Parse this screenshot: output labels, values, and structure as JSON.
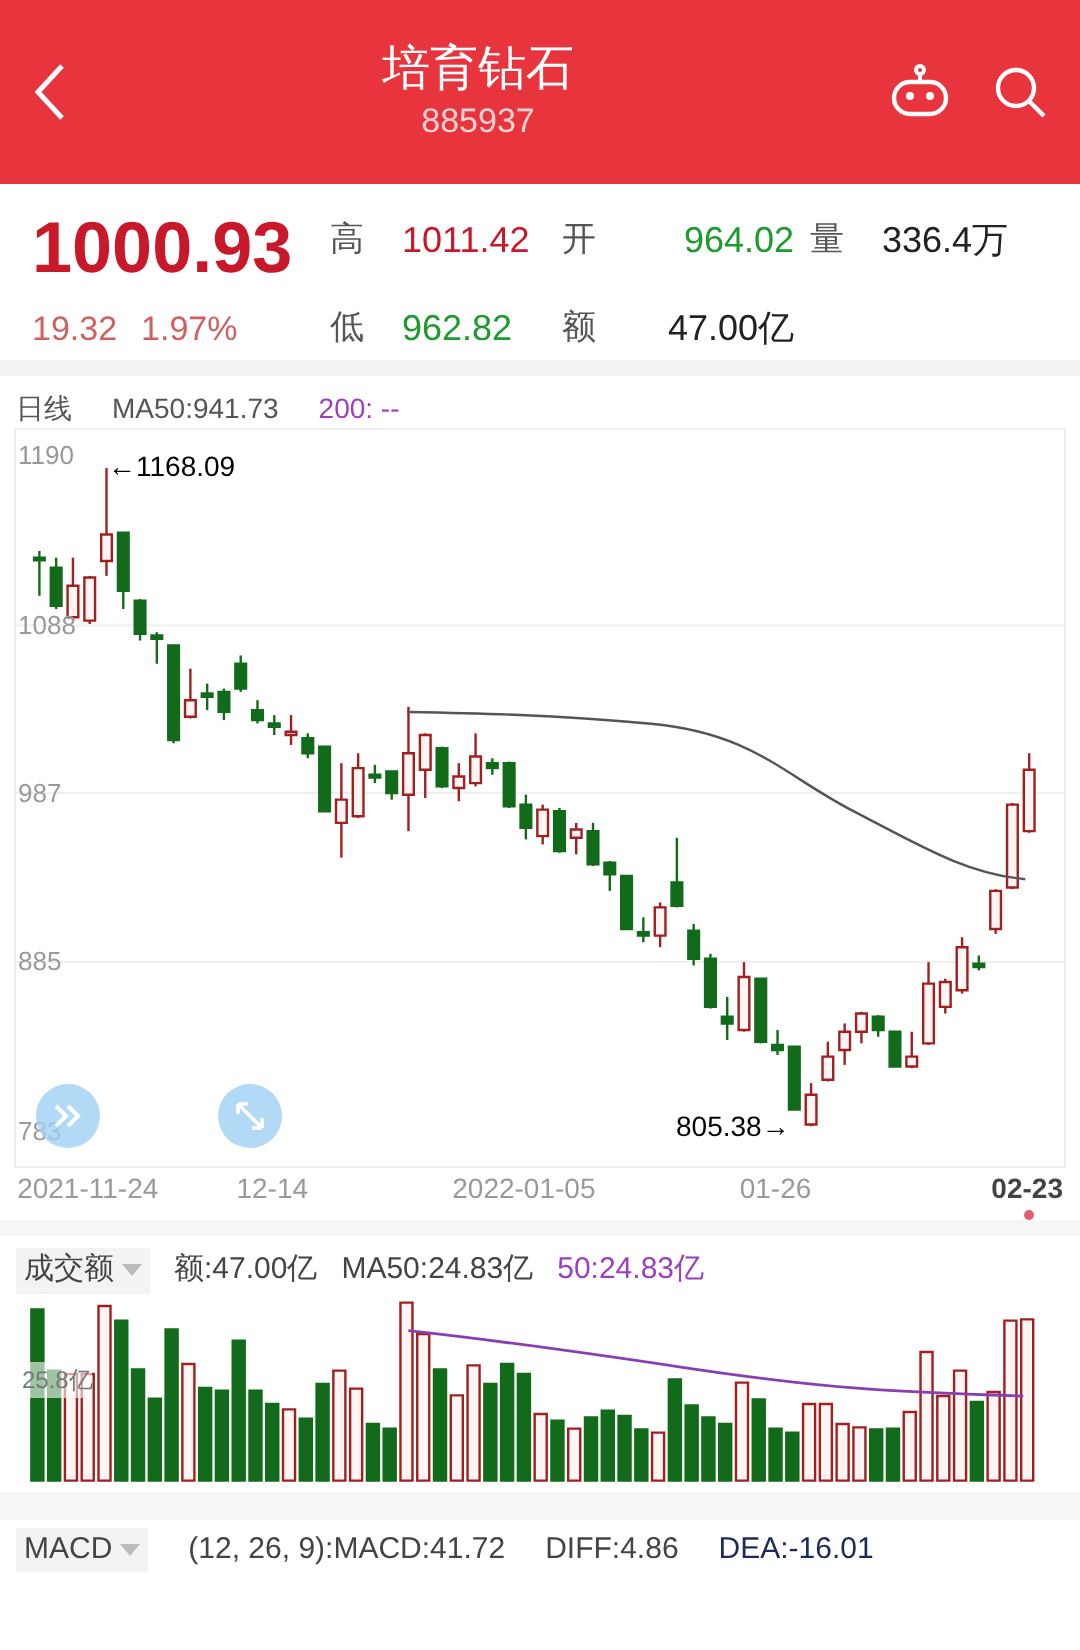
{
  "header": {
    "title": "培育钻石",
    "code": "885937"
  },
  "quote": {
    "price": "1000.93",
    "color": "#c8192a",
    "changes": [
      {
        "text": "19.32",
        "color": "#d06060"
      },
      {
        "text": "1.97%",
        "color": "#d06060"
      }
    ]
  },
  "stats": [
    [
      {
        "label": "高",
        "value": "1011.42",
        "color": "#c8192a"
      },
      {
        "label": "开",
        "value": "964.02",
        "color": "#1e9a2e"
      },
      {
        "label": "量",
        "value": "336.4万",
        "color": "#222222"
      }
    ],
    [
      {
        "label": "低",
        "value": "962.82",
        "color": "#1e9a2e"
      },
      {
        "label": "额",
        "value": "47.00亿",
        "color": "#222222"
      }
    ]
  ],
  "price_chart": {
    "period": "日线",
    "last_date_marked": true,
    "ma50": "MA50:941.73",
    "ma200": "200: --",
    "high_note": "←1168.09",
    "low_note": "805.38→",
    "chart_data": {
      "type": "candlestick",
      "ylim": [
        762,
        1206
      ],
      "yticks": [
        1190,
        1088,
        987,
        885,
        783
      ],
      "grid": true,
      "categories": [
        null,
        null,
        null,
        "2021-11-24",
        null,
        null,
        null,
        null,
        null,
        null,
        null,
        null,
        null,
        null,
        "12-14",
        null,
        null,
        null,
        null,
        null,
        null,
        null,
        null,
        null,
        null,
        null,
        null,
        null,
        null,
        "2022-01-05",
        null,
        null,
        null,
        null,
        null,
        null,
        null,
        null,
        null,
        null,
        null,
        null,
        null,
        null,
        "01-26",
        null,
        null,
        null,
        null,
        null,
        null,
        null,
        null,
        null,
        null,
        null,
        null,
        null,
        null,
        "02-23"
      ],
      "ohlc": [
        [
          1129,
          1133,
          1106,
          1128
        ],
        [
          1123,
          1129,
          1098,
          1100
        ],
        [
          1093,
          1129,
          1091,
          1112
        ],
        [
          1091,
          1118,
          1089,
          1117
        ],
        [
          1127,
          1183,
          1118,
          1143
        ],
        [
          1144,
          1144,
          1098,
          1109
        ],
        [
          1103,
          1104,
          1079,
          1083
        ],
        [
          1082,
          1084,
          1065,
          1080
        ],
        [
          1076,
          1076,
          1017,
          1019
        ],
        [
          1033,
          1062,
          1032,
          1043
        ],
        [
          1047,
          1053,
          1037,
          1045
        ],
        [
          1048,
          1050,
          1031,
          1036
        ],
        [
          1065,
          1070,
          1048,
          1050
        ],
        [
          1037,
          1043,
          1029,
          1031
        ],
        [
          1029,
          1034,
          1022,
          1027
        ],
        [
          1022,
          1034,
          1016,
          1024
        ],
        [
          1020,
          1023,
          1008,
          1011
        ],
        [
          1015,
          1015,
          976,
          976
        ],
        [
          969,
          1005,
          948,
          983
        ],
        [
          973,
          1011,
          972,
          1002
        ],
        [
          998,
          1004,
          993,
          997
        ],
        [
          1000,
          1000,
          983,
          987
        ],
        [
          986,
          1039,
          964,
          1011
        ],
        [
          1001,
          1023,
          984,
          1022
        ],
        [
          1014,
          1015,
          990,
          991
        ],
        [
          990,
          1005,
          982,
          997
        ],
        [
          993,
          1023,
          991,
          1009
        ],
        [
          1005,
          1008,
          998,
          1002
        ],
        [
          1005,
          1006,
          978,
          979
        ],
        [
          980,
          986,
          959,
          966
        ],
        [
          961,
          980,
          956,
          977
        ],
        [
          976,
          978,
          951,
          952
        ],
        [
          960,
          969,
          950,
          965
        ],
        [
          964,
          969,
          943,
          944
        ],
        [
          945,
          946,
          928,
          938
        ],
        [
          937,
          937,
          905,
          905
        ],
        [
          903,
          912,
          897,
          901
        ],
        [
          901,
          921,
          894,
          918
        ],
        [
          933,
          960,
          918,
          919
        ],
        [
          904,
          908,
          883,
          887
        ],
        [
          887,
          890,
          857,
          858
        ],
        [
          852,
          864,
          838,
          848
        ],
        [
          844,
          885,
          843,
          876
        ],
        [
          875,
          875,
          836,
          837
        ],
        [
          835,
          844,
          829,
          832
        ],
        [
          834,
          834,
          796,
          796
        ],
        [
          787,
          812,
          786,
          805
        ],
        [
          814,
          837,
          813,
          828
        ],
        [
          832,
          848,
          823,
          843
        ],
        [
          843,
          855,
          836,
          854
        ],
        [
          852,
          853,
          840,
          844
        ],
        [
          843,
          843,
          822,
          822
        ],
        [
          822,
          843,
          821,
          828
        ],
        [
          836,
          885,
          835,
          872
        ],
        [
          858,
          875,
          854,
          873
        ],
        [
          868,
          900,
          866,
          894
        ],
        [
          884,
          889,
          880,
          882
        ],
        [
          905,
          929,
          902,
          928
        ],
        [
          930,
          981,
          929,
          980
        ],
        [
          964,
          1011,
          963,
          1001
        ]
      ]
    }
  },
  "volume": {
    "selector": "成交额",
    "amount": "额:47.00亿",
    "ma50": "MA50:24.83亿",
    "ma50_alt": "50:24.83亿",
    "y_tick": "25.8亿"
  },
  "macd": {
    "selector": "MACD",
    "params": "(12, 26, 9):MACD:41.72",
    "diff": "DIFF:4.86",
    "dea": "DEA:-16.01"
  }
}
